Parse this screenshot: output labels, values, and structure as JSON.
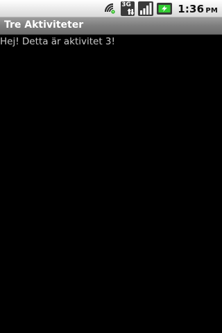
{
  "status_bar": {
    "icons": [
      "gps-icon",
      "3g-icon",
      "signal-icon",
      "battery-charging-icon"
    ],
    "network_type": "3G",
    "time": "1:36",
    "am_pm": "PM"
  },
  "title_bar": {
    "title": "Tre Aktiviteter"
  },
  "content": {
    "message": "Hej! Detta är aktivitet 3!"
  }
}
